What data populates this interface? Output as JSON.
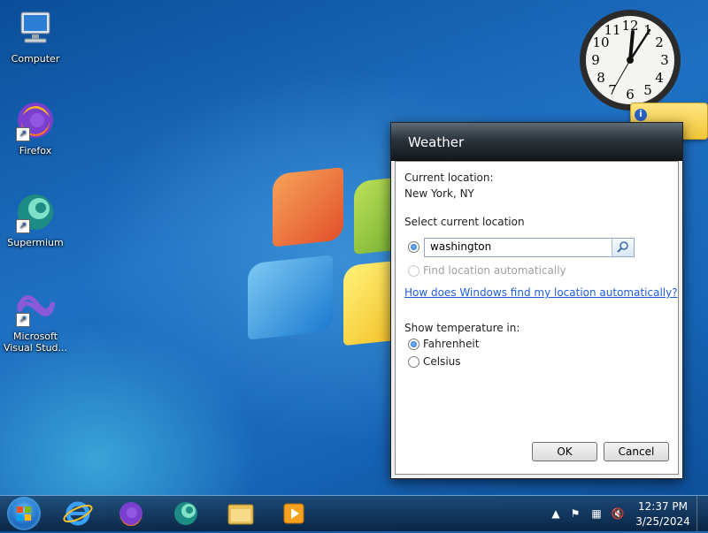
{
  "desktop": {
    "icons": [
      {
        "label": "Computer"
      },
      {
        "label": "Firefox"
      },
      {
        "label": "Supermium"
      },
      {
        "label": "Microsoft Visual Stud..."
      }
    ]
  },
  "clock_gadget": {
    "numbers": [
      "12",
      "1",
      "2",
      "3",
      "4",
      "5",
      "6",
      "7",
      "8",
      "9",
      "10",
      "11"
    ]
  },
  "weather_dialog": {
    "title": "Weather",
    "current_location_label": "Current location:",
    "current_location_value": "New York, NY",
    "select_location_label": "Select current location",
    "search_value": "washington",
    "find_auto_label": "Find location automatically",
    "help_link": "How does Windows find my location automatically?",
    "temperature_label": "Show temperature in:",
    "fahrenheit_label": "Fahrenheit",
    "celsius_label": "Celsius",
    "ok_label": "OK",
    "cancel_label": "Cancel"
  },
  "taskbar": {
    "time": "12:37 PM",
    "date": "3/25/2024"
  },
  "colors": {
    "accent": "#1f5ed8",
    "taskbar": "#12304f"
  }
}
